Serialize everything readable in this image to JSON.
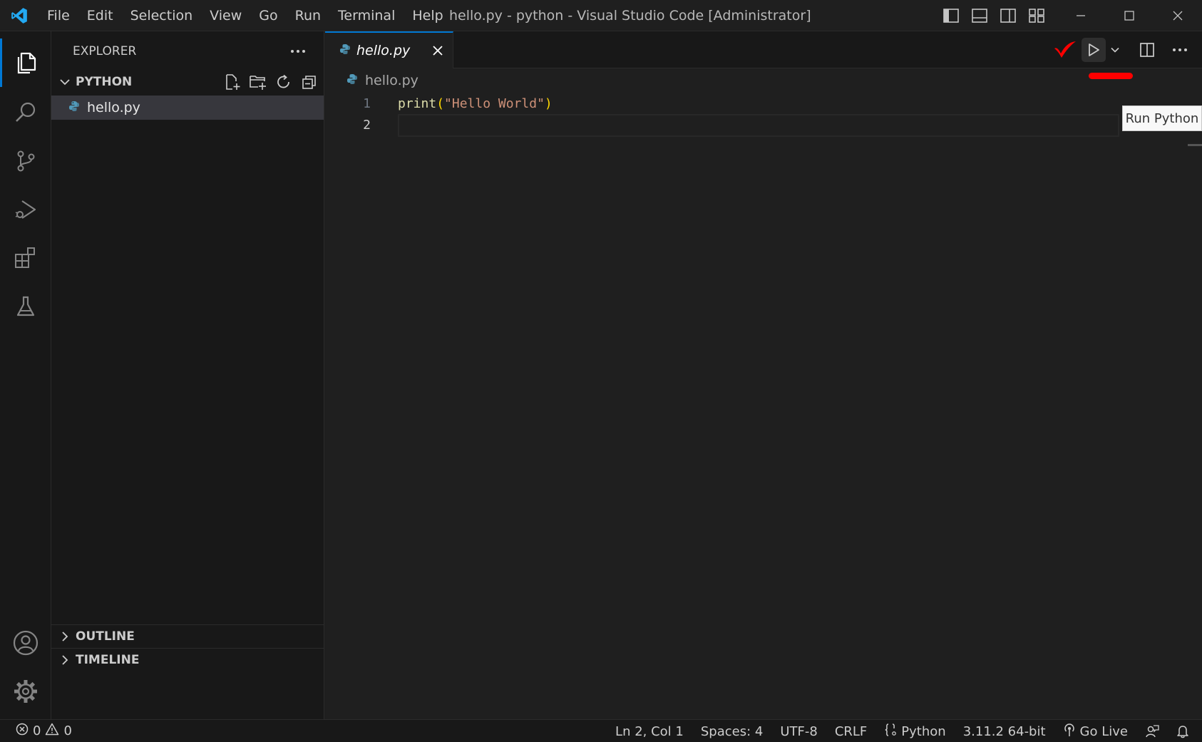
{
  "titlebar": {
    "menu": [
      "File",
      "Edit",
      "Selection",
      "View",
      "Go",
      "Run",
      "Terminal",
      "Help"
    ],
    "window_title": "hello.py - python - Visual Studio Code [Administrator]"
  },
  "activity_bar": {
    "items": [
      "explorer-icon",
      "search-icon",
      "source-control-icon",
      "run-debug-icon",
      "extensions-icon",
      "testing-icon"
    ],
    "bottom": [
      "account-icon",
      "settings-gear-icon"
    ]
  },
  "sidebar": {
    "header": "EXPLORER",
    "folder": "PYTHON",
    "files": [
      {
        "name": "hello.py"
      }
    ],
    "outline": "OUTLINE",
    "timeline": "TIMELINE"
  },
  "editor": {
    "tab": {
      "label": "hello.py"
    },
    "breadcrumb": "hello.py",
    "lines": [
      {
        "num": "1",
        "fn": "print",
        "open": "(",
        "str": "\"Hello World\"",
        "close": ")"
      },
      {
        "num": "2"
      }
    ],
    "tooltip": "Run Python"
  },
  "statusbar": {
    "errors": "0",
    "warnings": "0",
    "position": "Ln 2, Col 1",
    "spaces": "Spaces: 4",
    "encoding": "UTF-8",
    "eol": "CRLF",
    "language": "Python",
    "interpreter": "3.11.2 64-bit",
    "go_live": "Go Live"
  },
  "colors": {
    "accent": "#0078d4",
    "annotation": "#ff0000",
    "string": "#ce9178",
    "function": "#dcdcaa"
  }
}
